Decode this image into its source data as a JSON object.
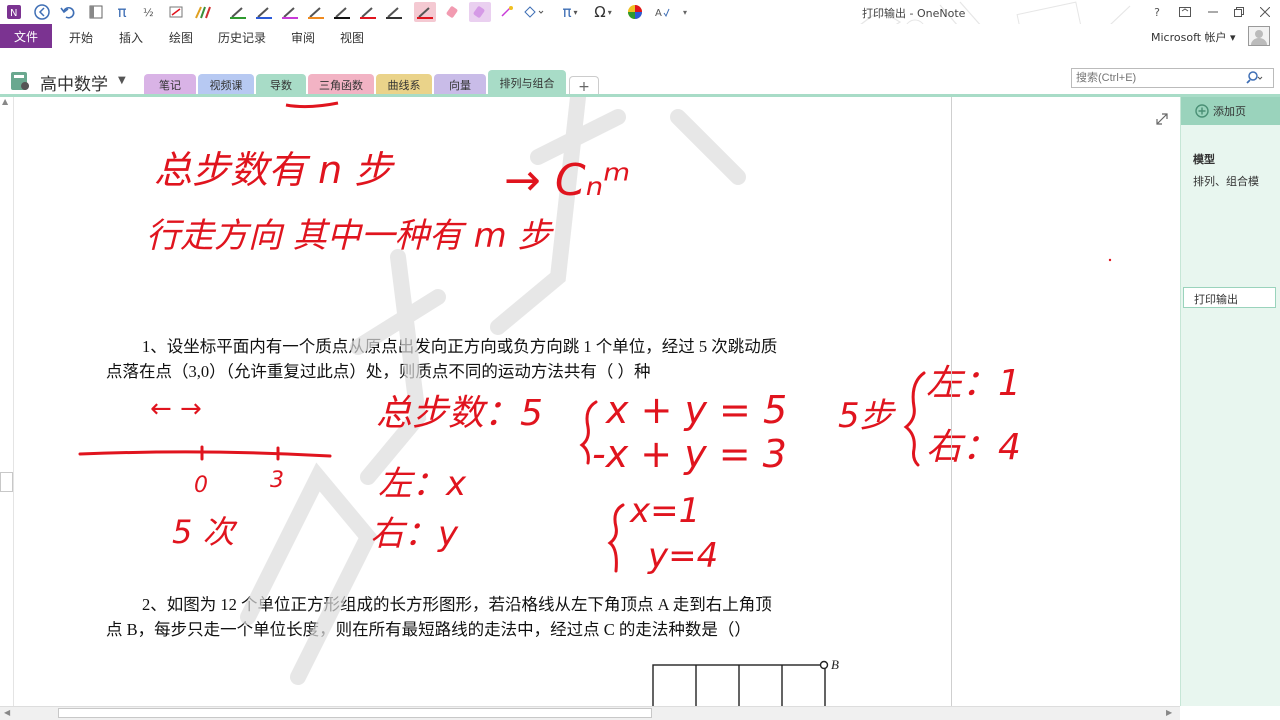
{
  "window": {
    "title": "打印输出 - OneNote",
    "help": "?",
    "account": "Microsoft 帐户"
  },
  "ribbon": {
    "file": "文件",
    "tabs": [
      "开始",
      "插入",
      "绘图",
      "历史记录",
      "审阅",
      "视图"
    ]
  },
  "notebook": {
    "name": "高中数学"
  },
  "sections": [
    {
      "label": "笔记",
      "color": "#d9b3e6"
    },
    {
      "label": "视频课",
      "color": "#b7c9f2"
    },
    {
      "label": "导数",
      "color": "#a8dcc7"
    },
    {
      "label": "三角函数",
      "color": "#f2b3c4"
    },
    {
      "label": "曲线系",
      "color": "#ead38a"
    },
    {
      "label": "向量",
      "color": "#c9bce8"
    },
    {
      "label": "排列与组合",
      "color": "#a8dcc7"
    }
  ],
  "search": {
    "placeholder": "搜索(Ctrl+E)"
  },
  "pane": {
    "add_page": "添加页",
    "pages": [
      "模型",
      "排列、组合模",
      "打印输出"
    ]
  },
  "content": {
    "problem1_line1": "1、设坐标平面内有一个质点从原点出发向正方向或负方向跳 1 个单位，经过 5 次跳动质",
    "problem1_line2": "点落在点（3,0）（允许重复过此点）处，则质点不同的运动方法共有（                  ）种",
    "problem2_line1": "2、如图为 12 个单位正方形组成的长方形图形，若沿格线从左下角顶点 A 走到右上角顶",
    "problem2_line2": "点 B，每步只走一个单位长度，则在所有最短路线的走法中，经过点 C 的走法种数是（）",
    "grid_label_b": "B",
    "ink": {
      "total_steps_n": "总步数有 n 步",
      "one_direction_m": "行走方向 其中一种有 m 步",
      "result": "→ Cₙᵐ",
      "arrows": "← →",
      "axis_0": "0",
      "axis_3": "3",
      "times_5": "5 次",
      "total_5": "总步数：5",
      "left_x": "左：x",
      "right_y": "右：y",
      "eq1": "x + y = 5",
      "eq2": "-x + y = 3",
      "sol1": "x=1",
      "sol2": "y=4",
      "steps5": "5步",
      "left1": "左：1",
      "right4": "右：4"
    }
  },
  "colors": {
    "ink": "#e0141e",
    "file_tab": "#7b3391",
    "accent": "#a8dcc7"
  }
}
